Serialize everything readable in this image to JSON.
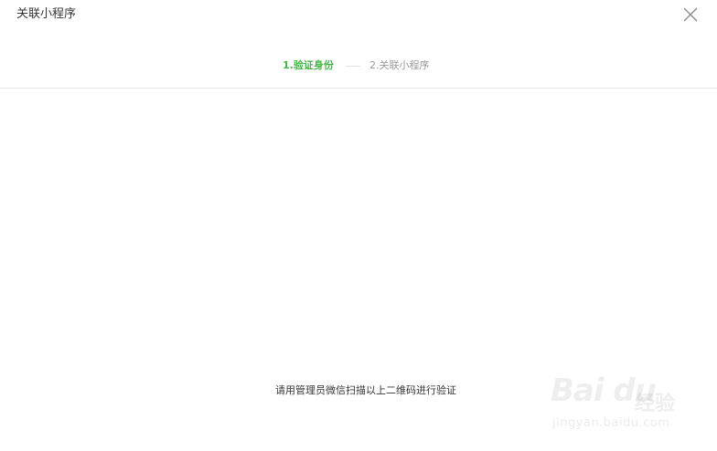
{
  "dialog": {
    "title": "关联小程序",
    "close_icon": "close-icon"
  },
  "steps": [
    {
      "label": "1.验证身份",
      "state": "active"
    },
    {
      "label": "2.关联小程序",
      "state": "inactive"
    }
  ],
  "qr": {
    "instruction": "请用管理员微信扫描以上二维码进行验证"
  },
  "watermark": {
    "logo": "Bai du",
    "text": "经验",
    "url": "jingyan.baidu.com"
  },
  "colors": {
    "accent": "#44b549",
    "inactive_text": "#9a9a9a",
    "divider": "#e7e7eb",
    "text": "#353535"
  }
}
